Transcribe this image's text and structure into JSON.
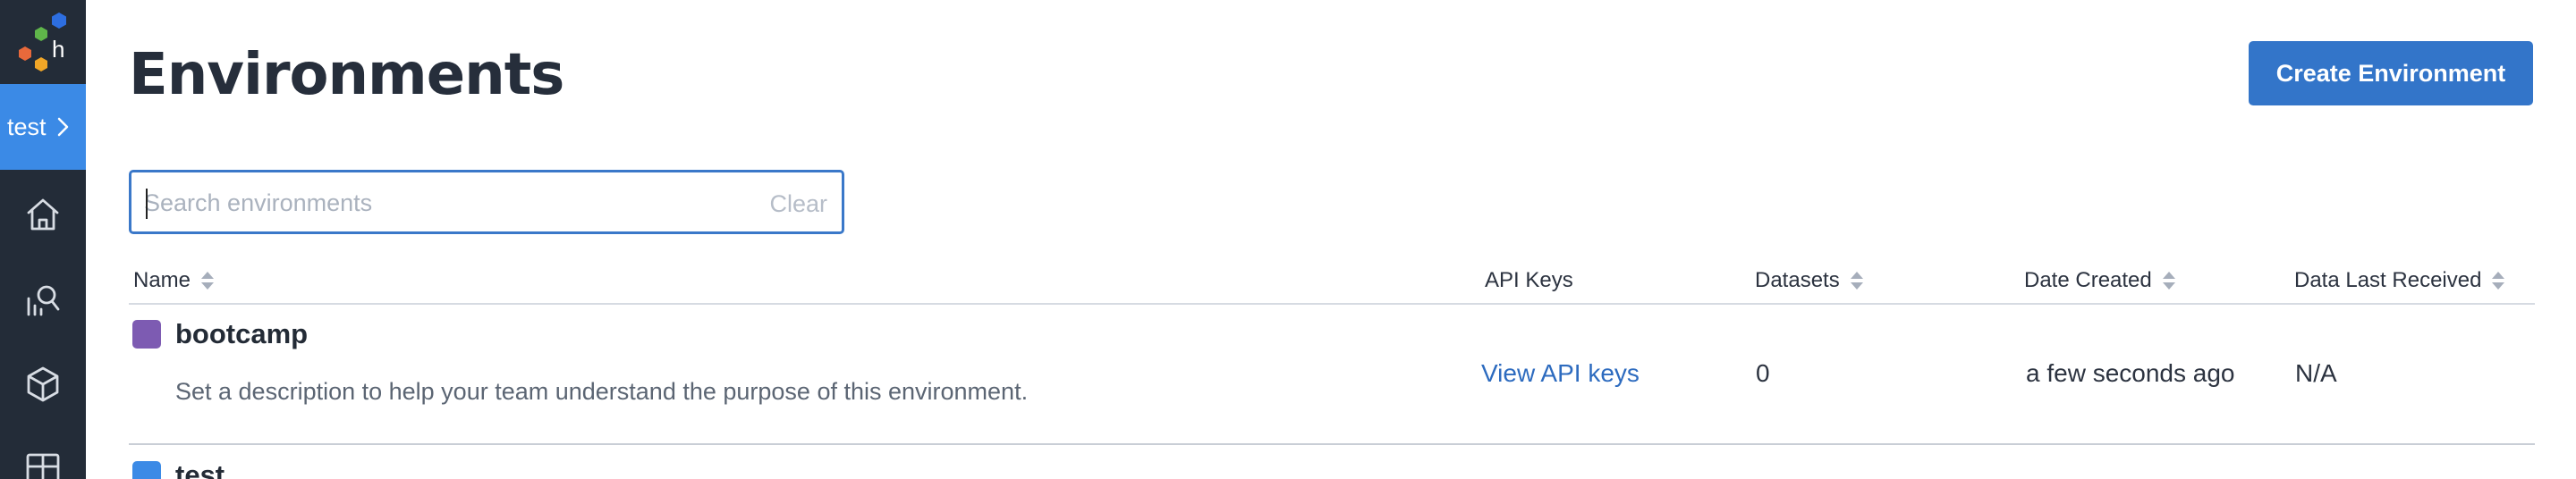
{
  "sidebar": {
    "env_switcher": {
      "label": "test"
    },
    "nav": [
      {
        "name": "home",
        "icon": "home-icon"
      },
      {
        "name": "query",
        "icon": "query-chart-icon"
      },
      {
        "name": "datasets",
        "icon": "cube-icon"
      },
      {
        "name": "boards",
        "icon": "grid-icon"
      }
    ]
  },
  "header": {
    "title": "Environments",
    "create_button": "Create Environment"
  },
  "search": {
    "placeholder": "Search environments",
    "value": "",
    "clear_label": "Clear"
  },
  "table": {
    "columns": [
      {
        "label": "Name",
        "sortable": true
      },
      {
        "label": "API Keys",
        "sortable": false
      },
      {
        "label": "Datasets",
        "sortable": true
      },
      {
        "label": "Date Created",
        "sortable": true
      },
      {
        "label": "Data Last Received",
        "sortable": true
      }
    ],
    "rows": [
      {
        "name": "bootcamp",
        "color": "#7d5bb2",
        "description": "Set a description to help your team understand the purpose of this environment.",
        "api_keys": "View API keys",
        "datasets": "0",
        "date_created": "a few seconds ago",
        "data_last_received": "N/A"
      },
      {
        "name": "test",
        "color": "#3b8ae6"
      }
    ]
  },
  "colors": {
    "sidebar_bg": "#232c38",
    "accent": "#3b8ae6",
    "button": "#3375c9",
    "link": "#2d6bbf"
  }
}
